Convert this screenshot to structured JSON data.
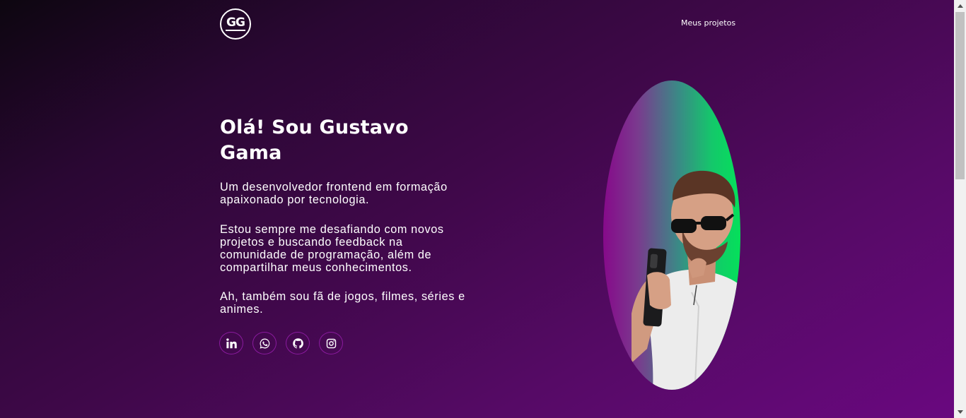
{
  "header": {
    "logo_text": "GG",
    "nav": {
      "projects_label": "Meus projetos"
    }
  },
  "hero": {
    "title": "Olá! Sou Gustavo Gama",
    "paragraphs": [
      "Um desenvolvedor frontend em formação apaixonado por tecnologia.",
      "Estou sempre me desafiando com novos projetos e buscando feedback na comunidade de programação, além de compartilhar meus conhecimentos.",
      "Ah, também sou fã de jogos, filmes, séries e animes."
    ],
    "socials": [
      {
        "icon": "linkedin-icon"
      },
      {
        "icon": "whatsapp-icon"
      },
      {
        "icon": "github-icon"
      },
      {
        "icon": "instagram-icon"
      }
    ]
  },
  "portrait": {
    "gradient_colors": [
      "#860a8a",
      "#05e05a"
    ]
  },
  "colors": {
    "background_start": "#0d0610",
    "background_end": "#6a0880",
    "social_border": "#8a1a9e",
    "text": "#ffffff"
  }
}
